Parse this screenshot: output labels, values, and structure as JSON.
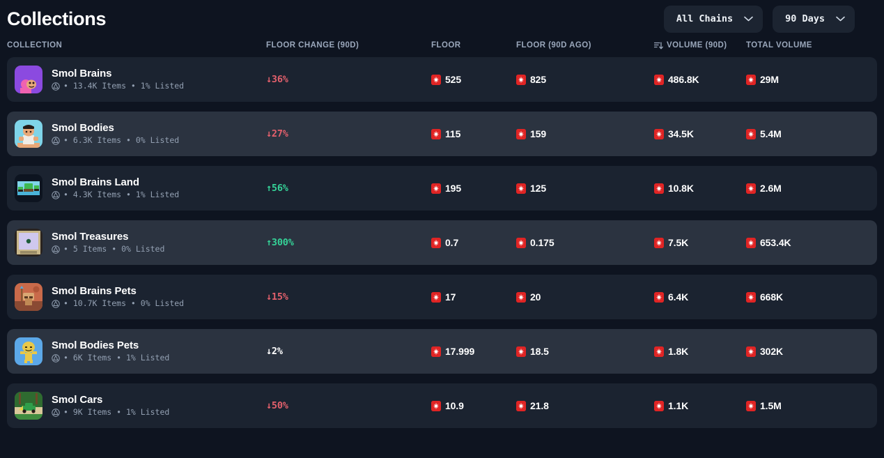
{
  "header": {
    "title": "Collections",
    "chain_filter": {
      "label": "All Chains",
      "icon": "chevron-down-icon"
    },
    "period_filter": {
      "label": "90 Days",
      "icon": "chevron-down-icon"
    }
  },
  "table": {
    "columns": [
      {
        "key": "collection",
        "label": "COLLECTION",
        "icon": null
      },
      {
        "key": "floor_change",
        "label": "FLOOR CHANGE (90D)",
        "icon": null
      },
      {
        "key": "floor",
        "label": "FLOOR",
        "icon": null
      },
      {
        "key": "floor_90d_ago",
        "label": "FLOOR (90D AGO)",
        "icon": null
      },
      {
        "key": "volume_90d",
        "label": "VOLUME (90D)",
        "icon": "sort-descending-icon"
      },
      {
        "key": "total_volume",
        "label": "TOTAL VOLUME",
        "icon": null
      }
    ],
    "rows": [
      {
        "name": "Smol Brains",
        "meta": "• 13.4K Items • 1% Listed",
        "chain_icon": "chain-icon",
        "avatar": "smol-brains-avatar",
        "change": "↓36%",
        "change_dir": "down",
        "floor": "525",
        "floor_90d_ago": "825",
        "volume_90d": "486.8K",
        "total_volume": "29M"
      },
      {
        "name": "Smol Bodies",
        "meta": "• 6.3K Items • 0% Listed",
        "chain_icon": "chain-icon",
        "avatar": "smol-bodies-avatar",
        "change": "↓27%",
        "change_dir": "down",
        "floor": "115",
        "floor_90d_ago": "159",
        "volume_90d": "34.5K",
        "total_volume": "5.4M"
      },
      {
        "name": "Smol Brains Land",
        "meta": "• 4.3K Items • 1% Listed",
        "chain_icon": "chain-icon",
        "avatar": "smol-brains-land-avatar",
        "change": "↑56%",
        "change_dir": "up",
        "floor": "195",
        "floor_90d_ago": "125",
        "volume_90d": "10.8K",
        "total_volume": "2.6M"
      },
      {
        "name": "Smol Treasures",
        "meta": "• 5 Items • 0% Listed",
        "chain_icon": "chain-icon",
        "avatar": "smol-treasures-avatar",
        "change": "↑300%",
        "change_dir": "up",
        "floor": "0.7",
        "floor_90d_ago": "0.175",
        "volume_90d": "7.5K",
        "total_volume": "653.4K"
      },
      {
        "name": "Smol Brains Pets",
        "meta": "• 10.7K Items • 0% Listed",
        "chain_icon": "chain-icon",
        "avatar": "smol-brains-pets-avatar",
        "change": "↓15%",
        "change_dir": "down",
        "floor": "17",
        "floor_90d_ago": "20",
        "volume_90d": "6.4K",
        "total_volume": "668K"
      },
      {
        "name": "Smol Bodies Pets",
        "meta": "• 6K Items • 1% Listed",
        "chain_icon": "chain-icon",
        "avatar": "smol-bodies-pets-avatar",
        "change": "↓2%",
        "change_dir": "flat",
        "floor": "17.999",
        "floor_90d_ago": "18.5",
        "volume_90d": "1.8K",
        "total_volume": "302K"
      },
      {
        "name": "Smol Cars",
        "meta": "• 9K Items • 1% Listed",
        "chain_icon": "chain-icon",
        "avatar": "smol-cars-avatar",
        "change": "↓50%",
        "change_dir": "down",
        "floor": "10.9",
        "floor_90d_ago": "21.8",
        "volume_90d": "1.1K",
        "total_volume": "1.5M"
      }
    ]
  },
  "colors": {
    "page_bg": "#0e1420",
    "row_bg": "#1b2330",
    "row_bg_alt": "#2b3340",
    "positive": "#35d398",
    "negative": "#e3606c",
    "token_red": "#e02424",
    "muted_text": "#93a0b2"
  },
  "currency_icon": "magic-token-icon"
}
